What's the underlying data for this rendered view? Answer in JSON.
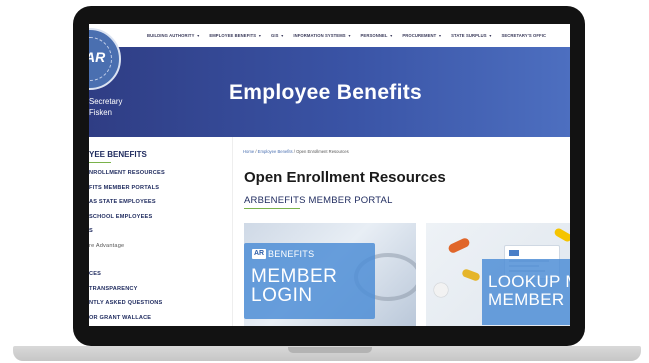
{
  "topnav": {
    "items": [
      "BUILDING AUTHORITY",
      "EMPLOYEE BENEFITS",
      "GIS",
      "INFORMATION SYSTEMS",
      "PERSONNEL",
      "PROCUREMENT",
      "STATE SURPLUS",
      "SECRETARY'S OFFIC"
    ],
    "caret": "▼"
  },
  "header": {
    "seal_text": "AR",
    "office_line1": "Secretary",
    "office_line2": "Fisken",
    "title": "Employee Benefits"
  },
  "sidebar": {
    "header": "YEE BENEFITS",
    "items": [
      "NROLLMENT RESOURCES",
      "FITS MEMBER PORTALS",
      "AS STATE EMPLOYEES",
      "SCHOOL EMPLOYEES",
      "S",
      "re Advantage",
      "CES",
      "TRANSPARENCY",
      "NTLY ASKED QUESTIONS",
      "OR GRANT WALLACE"
    ]
  },
  "content": {
    "breadcrumb": {
      "home": "Home",
      "section": "Employee Benefits",
      "current": "Open Enrollment Resources",
      "separator": " / "
    },
    "title": "Open Enrollment Resources",
    "portal_heading": "ARBENEFITS MEMBER PORTAL",
    "card_member": {
      "badge": "AR",
      "brand": "BENEFITS",
      "line1": "MEMBER",
      "line2": "LOGIN"
    },
    "card_lookup": {
      "line1": "LOOKUP M",
      "line2": "MEMBER"
    }
  },
  "colors": {
    "hero_start": "#2f3d84",
    "hero_end": "#4d6fc0",
    "accent_green": "#7ab24a",
    "navy_text": "#1e2a5e",
    "card_blue": "#4f8ed6"
  }
}
